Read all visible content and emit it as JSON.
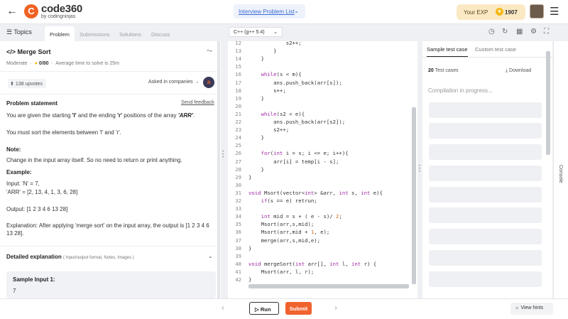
{
  "topbar": {
    "logo_mark": "C",
    "logo_name": "code360",
    "logo_sub": "by codingninjas",
    "problem_list": "Interview Problem List",
    "exp_label": "Your EXP",
    "exp_value": "1907"
  },
  "tabs": {
    "topics": "Topics",
    "problem": "Problem",
    "submissions": "Submissions",
    "solutions": "Solutions",
    "discuss": "Discuss"
  },
  "editor_lang": "C++ (g++ 5.4)",
  "problem": {
    "title": "Merge Sort",
    "difficulty": "Moderate",
    "score": "0/80",
    "avg_time": "Average time to solve is 25m",
    "upvotes": "138 upvotes",
    "asked": "Asked in companies",
    "statement_heading": "Problem statement",
    "send_feedback": "Send feedback",
    "p1a": "You are given the starting ",
    "p1b": "'l'",
    "p1c": " and the ending ",
    "p1d": "'r'",
    "p1e": " positions of the array ",
    "p1f": "'ARR'",
    "p1g": ".",
    "p2": "You must sort the elements between 'l' and 'r'.",
    "note_heading": "Note:",
    "note": "Change in the input array itself. So no need to return or print anything.",
    "example_heading": "Example:",
    "input1": "Input: 'N' = 7,",
    "input2": "'ARR' = [2, 13, 4, 1, 3, 6, 28]",
    "output": "Output: [1 2 3 4 6 13 28]",
    "explanation": "Explanation: After applying 'merge sort' on the input array, the output is [1 2 3 4 6 13 28].",
    "detailed": "Detailed explanation",
    "detailed_sub": "( Input/output format, Notes, Images )",
    "sample_title": "Sample Input 1:",
    "sample_val": "7"
  },
  "code": [
    {
      "n": "12",
      "t": "            s2++;"
    },
    {
      "n": "13",
      "t": "        }"
    },
    {
      "n": "14",
      "t": "    }"
    },
    {
      "n": "15",
      "t": ""
    },
    {
      "n": "16",
      "t": "    while(s < m){"
    },
    {
      "n": "17",
      "t": "        ans.push_back(arr[s]);"
    },
    {
      "n": "18",
      "t": "        s++;"
    },
    {
      "n": "19",
      "t": "    }"
    },
    {
      "n": "20",
      "t": ""
    },
    {
      "n": "21",
      "t": "    while(s2 < e){"
    },
    {
      "n": "22",
      "t": "        ans.push_back(arr[s2]);"
    },
    {
      "n": "23",
      "t": "        s2++;"
    },
    {
      "n": "24",
      "t": "    }"
    },
    {
      "n": "25",
      "t": ""
    },
    {
      "n": "26",
      "t": "    for(int i = s; i <= e; i++){"
    },
    {
      "n": "27",
      "t": "        arr[i] = temp[i - s];"
    },
    {
      "n": "28",
      "t": "    }"
    },
    {
      "n": "29",
      "t": "}"
    },
    {
      "n": "30",
      "t": ""
    },
    {
      "n": "31",
      "t": "void Msort(vector<int> &arr, int s, int e){"
    },
    {
      "n": "32",
      "t": "    if(s == e) retrun;"
    },
    {
      "n": "33",
      "t": ""
    },
    {
      "n": "34",
      "t": "    int mid = s + ( e - s)/ 2;"
    },
    {
      "n": "35",
      "t": "    Msort(arr,s,mid);"
    },
    {
      "n": "36",
      "t": "    Msort(arr,mid + 1, e);"
    },
    {
      "n": "37",
      "t": "    merge(arr,s,mid,e);"
    },
    {
      "n": "38",
      "t": "}"
    },
    {
      "n": "39",
      "t": ""
    },
    {
      "n": "40",
      "t": "void mergeSort(int arr[], int l, int r) {"
    },
    {
      "n": "41",
      "t": "    Msort(arr, l, r);"
    },
    {
      "n": "42",
      "t": "}"
    }
  ],
  "right": {
    "tab_sample": "Sample test case",
    "tab_custom": "Custom test case",
    "count": "20",
    "count_label": " Test cases",
    "download": "Download",
    "status": "Compilation in progress...",
    "console": "Console"
  },
  "bottom": {
    "run": "Run",
    "submit": "Submit",
    "hints": "View hints"
  }
}
